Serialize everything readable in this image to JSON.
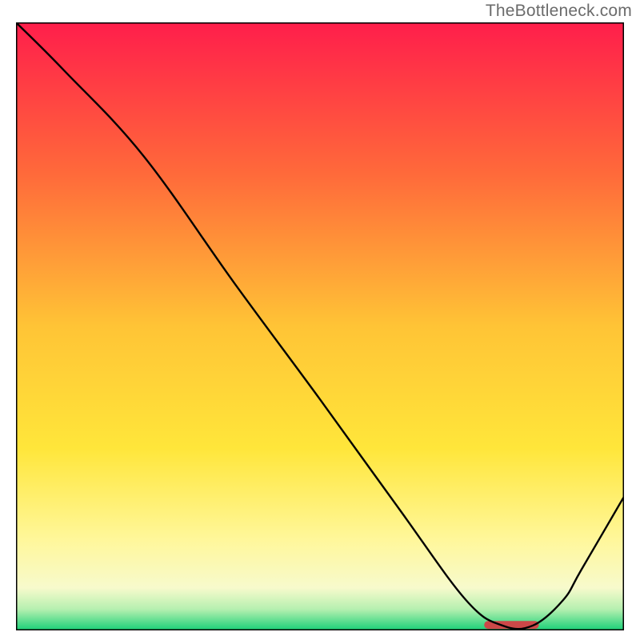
{
  "attribution": "TheBottleneck.com",
  "chart_data": {
    "type": "line",
    "title": "",
    "xlabel": "",
    "ylabel": "",
    "xlim": [
      0,
      100
    ],
    "ylim": [
      0,
      100
    ],
    "grid": false,
    "legend": false,
    "background": {
      "type": "vertical-gradient",
      "stops": [
        {
          "pos": 0.0,
          "color": "#ff1e4b"
        },
        {
          "pos": 0.25,
          "color": "#ff6a3a"
        },
        {
          "pos": 0.5,
          "color": "#ffc436"
        },
        {
          "pos": 0.7,
          "color": "#ffe63a"
        },
        {
          "pos": 0.85,
          "color": "#fff79a"
        },
        {
          "pos": 0.93,
          "color": "#f7facc"
        },
        {
          "pos": 0.965,
          "color": "#b6f0b0"
        },
        {
          "pos": 1.0,
          "color": "#18d077"
        }
      ]
    },
    "series": [
      {
        "name": "bottleneck-curve",
        "color": "#000000",
        "x": [
          0,
          8,
          21,
          36,
          50,
          63,
          74,
          80,
          85,
          90,
          93,
          100
        ],
        "values": [
          100,
          92,
          78,
          57,
          38,
          20,
          5,
          0.8,
          0.8,
          5,
          10,
          22
        ]
      }
    ],
    "markers": [
      {
        "name": "optimal-range",
        "type": "bar",
        "color": "#cc4848",
        "x_start": 77,
        "x_end": 86,
        "y": 0.9,
        "thickness": 1.3
      }
    ]
  }
}
